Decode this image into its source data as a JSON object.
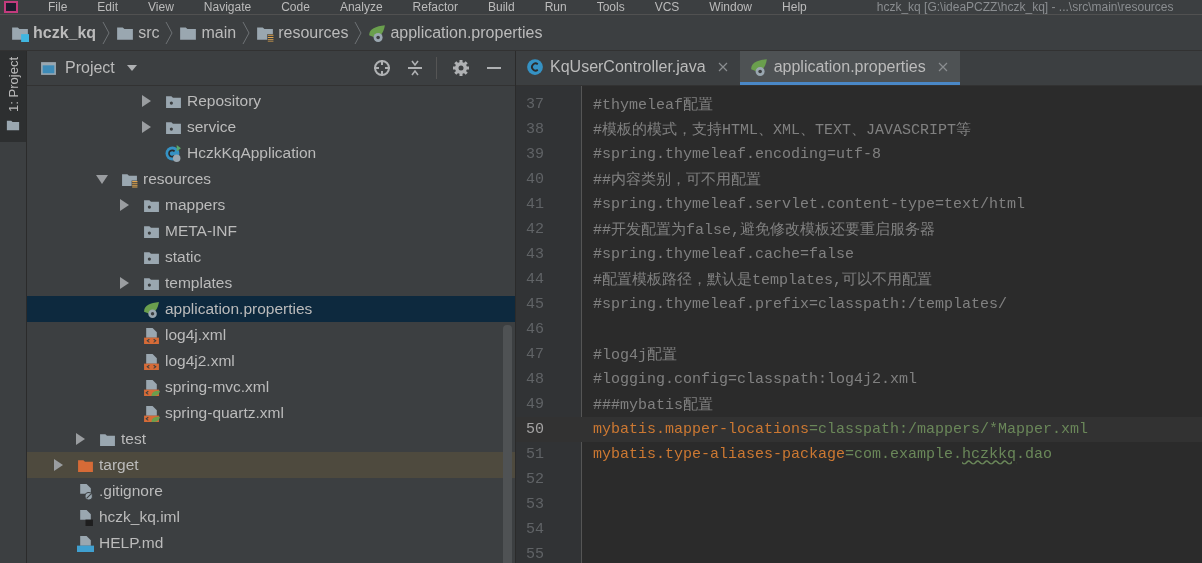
{
  "menu_bar": {
    "items": [
      "File",
      "Edit",
      "View",
      "Navigate",
      "Code",
      "Analyze",
      "Refactor",
      "Build",
      "Run",
      "Tools",
      "VCS",
      "Window",
      "Help"
    ],
    "title": "hczk_kq [G:\\ideaPCZZ\\hczk_kq] - ...\\src\\main\\resources"
  },
  "breadcrumbs": [
    {
      "label": "hczk_kq",
      "kind": "module"
    },
    {
      "label": "src",
      "kind": "folder"
    },
    {
      "label": "main",
      "kind": "folder"
    },
    {
      "label": "resources",
      "kind": "resources"
    },
    {
      "label": "application.properties",
      "kind": "properties"
    }
  ],
  "tool_stripe": {
    "label": "1: Project",
    "selected": true
  },
  "project_panel": {
    "title": "Project",
    "tree": [
      {
        "children": [
          {
            "children": [
              {
                "children": [
                  {
                    "children": [
                      {
                        "label": "Repository",
                        "kind": "package",
                        "expanded": false,
                        "selected": false
                      },
                      {
                        "label": "service",
                        "kind": "package",
                        "expanded": false,
                        "selected": false
                      },
                      {
                        "label": "HczkKqApplication",
                        "kind": "spring-class",
                        "selected": false
                      }
                    ]
                  }
                ]
              },
              {
                "label": "resources",
                "kind": "resources",
                "expanded": true,
                "selected": false,
                "children": [
                  {
                    "label": "mappers",
                    "kind": "package",
                    "expanded": false,
                    "selected": false
                  },
                  {
                    "label": "META-INF",
                    "kind": "package",
                    "selected": false
                  },
                  {
                    "label": "static",
                    "kind": "package",
                    "selected": false
                  },
                  {
                    "label": "templates",
                    "kind": "package",
                    "expanded": false,
                    "selected": false
                  },
                  {
                    "label": "application.properties",
                    "kind": "properties",
                    "selected": true
                  },
                  {
                    "label": "log4j.xml",
                    "kind": "xml",
                    "selected": false
                  },
                  {
                    "label": "log4j2.xml",
                    "kind": "xml",
                    "selected": false
                  },
                  {
                    "label": "spring-mvc.xml",
                    "kind": "spring-xml",
                    "selected": false
                  },
                  {
                    "label": "spring-quartz.xml",
                    "kind": "spring-xml",
                    "selected": false
                  }
                ]
              }
            ]
          },
          {
            "label": "test",
            "kind": "folder",
            "expanded": false,
            "selected": false
          }
        ]
      },
      {
        "label": "target",
        "kind": "excluded",
        "expanded": false,
        "selected": false
      },
      {
        "label": ".gitignore",
        "kind": "gitignore",
        "selected": false
      },
      {
        "label": "hczk_kq.iml",
        "kind": "iml",
        "selected": false
      },
      {
        "label": "HELP.md",
        "kind": "markdown",
        "selected": false
      }
    ]
  },
  "editor": {
    "tabs": [
      {
        "label": "KqUserController.java",
        "kind": "class",
        "selected": false
      },
      {
        "label": "application.properties",
        "kind": "properties",
        "selected": true
      }
    ],
    "lines": [
      {
        "number": "37",
        "current": false,
        "segments": [
          {
            "kind": "comment",
            "text": "#thymeleaf配置"
          }
        ]
      },
      {
        "number": "38",
        "current": false,
        "segments": [
          {
            "kind": "comment",
            "text": "#模板的模式，支持HTML、XML、TEXT、JAVASCRIPT等"
          }
        ]
      },
      {
        "number": "39",
        "current": false,
        "segments": [
          {
            "kind": "comment",
            "text": "#spring.thymeleaf.encoding=utf-8"
          }
        ]
      },
      {
        "number": "40",
        "current": false,
        "segments": [
          {
            "kind": "comment",
            "text": "##内容类别，可不用配置"
          }
        ]
      },
      {
        "number": "41",
        "current": false,
        "segments": [
          {
            "kind": "comment",
            "text": "#spring.thymeleaf.servlet.content-type=text/html"
          }
        ]
      },
      {
        "number": "42",
        "current": false,
        "segments": [
          {
            "kind": "comment",
            "text": "##开发配置为false,避免修改模板还要重启服务器"
          }
        ]
      },
      {
        "number": "43",
        "current": false,
        "segments": [
          {
            "kind": "comment",
            "text": "#spring.thymeleaf.cache=false"
          }
        ]
      },
      {
        "number": "44",
        "current": false,
        "segments": [
          {
            "kind": "comment",
            "text": "#配置模板路径，默认是templates,可以不用配置"
          }
        ]
      },
      {
        "number": "45",
        "current": false,
        "segments": [
          {
            "kind": "comment",
            "text": "#spring.thymeleaf.prefix=classpath:/templates/"
          }
        ]
      },
      {
        "number": "46",
        "current": false
      },
      {
        "number": "47",
        "current": false,
        "segments": [
          {
            "kind": "comment",
            "text": "#log4j配置"
          }
        ]
      },
      {
        "number": "48",
        "current": false,
        "segments": [
          {
            "kind": "comment",
            "text": "#logging.config=classpath:log4j2.xml"
          }
        ]
      },
      {
        "number": "49",
        "current": false,
        "segments": [
          {
            "kind": "comment",
            "text": "###mybatis配置"
          }
        ]
      },
      {
        "number": "50",
        "current": true,
        "segments": [
          {
            "kind": "key",
            "text": "mybatis.mapper-locations"
          },
          {
            "kind": "value",
            "text": "=classpath:/mappers/*Mapper.xml"
          }
        ]
      },
      {
        "number": "51",
        "current": false,
        "segments": [
          {
            "kind": "key",
            "text": "mybatis.type-aliases-package"
          },
          {
            "kind": "value",
            "text": "=com.example."
          },
          {
            "kind": "typo",
            "text": "hczkkq"
          },
          {
            "kind": "value",
            "text": ".dao"
          }
        ]
      },
      {
        "number": "52",
        "current": false
      },
      {
        "number": "53",
        "current": false
      },
      {
        "number": "54",
        "current": false
      },
      {
        "number": "55",
        "current": false
      }
    ]
  }
}
